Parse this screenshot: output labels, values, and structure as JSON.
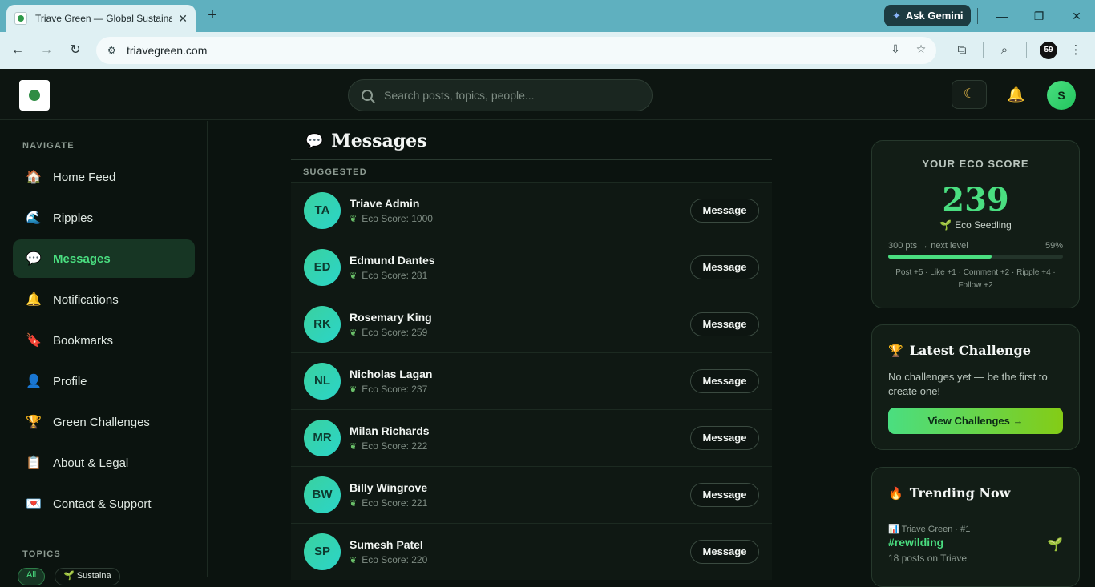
{
  "browser": {
    "tab_title": "Triave Green — Global Sustaina",
    "url": "triavegreen.com",
    "gemini_label": "Ask Gemini",
    "profile_initials": "59"
  },
  "header": {
    "search_placeholder": "Search posts, topics, people...",
    "avatar_initial": "S"
  },
  "sidebar": {
    "heading": "NAVIGATE",
    "items": [
      {
        "label": "Home Feed",
        "icon": "🏠"
      },
      {
        "label": "Ripples",
        "icon": "🌊"
      },
      {
        "label": "Messages",
        "icon": "💬"
      },
      {
        "label": "Notifications",
        "icon": "🔔"
      },
      {
        "label": "Bookmarks",
        "icon": "🔖"
      },
      {
        "label": "Profile",
        "icon": "👤"
      },
      {
        "label": "Green Challenges",
        "icon": "🏆"
      },
      {
        "label": "About & Legal",
        "icon": "📋"
      },
      {
        "label": "Contact & Support",
        "icon": "💌"
      }
    ],
    "active_index": 2,
    "topics_heading": "TOPICS",
    "topics": [
      "All",
      "🌱 Sustaina"
    ]
  },
  "main": {
    "title": "Messages",
    "section": "SUGGESTED",
    "button_label": "Message",
    "users": [
      {
        "initials": "TA",
        "name": "Triave Admin",
        "score": "Eco Score: 1000"
      },
      {
        "initials": "ED",
        "name": "Edmund Dantes",
        "score": "Eco Score: 281"
      },
      {
        "initials": "RK",
        "name": "Rosemary King",
        "score": "Eco Score: 259"
      },
      {
        "initials": "NL",
        "name": "Nicholas Lagan",
        "score": "Eco Score: 237"
      },
      {
        "initials": "MR",
        "name": "Milan Richards",
        "score": "Eco Score: 222"
      },
      {
        "initials": "BW",
        "name": "Billy Wingrove",
        "score": "Eco Score: 221"
      },
      {
        "initials": "SP",
        "name": "Sumesh Patel",
        "score": "Eco Score: 220"
      }
    ]
  },
  "eco": {
    "heading": "YOUR ECO SCORE",
    "score": "239",
    "level": "Eco Seedling",
    "next": "300 pts → next level",
    "progress_pct": "59%",
    "progress_value": 0.59,
    "rules": "Post +5 · Like +1 · Comment +2 · Ripple +4 · Follow +2"
  },
  "challenge": {
    "title": "Latest Challenge",
    "text": "No challenges yet — be the first to create one!",
    "button": "View Challenges →"
  },
  "trending": {
    "title": "Trending Now",
    "meta": "Triave Green · #1",
    "tag": "#rewilding",
    "count": "18 posts on Triave"
  },
  "colors": {
    "accent": "#4ade80",
    "background": "#0b130f",
    "card": "#121d16",
    "avatar_gradient": "#3ad29f"
  }
}
